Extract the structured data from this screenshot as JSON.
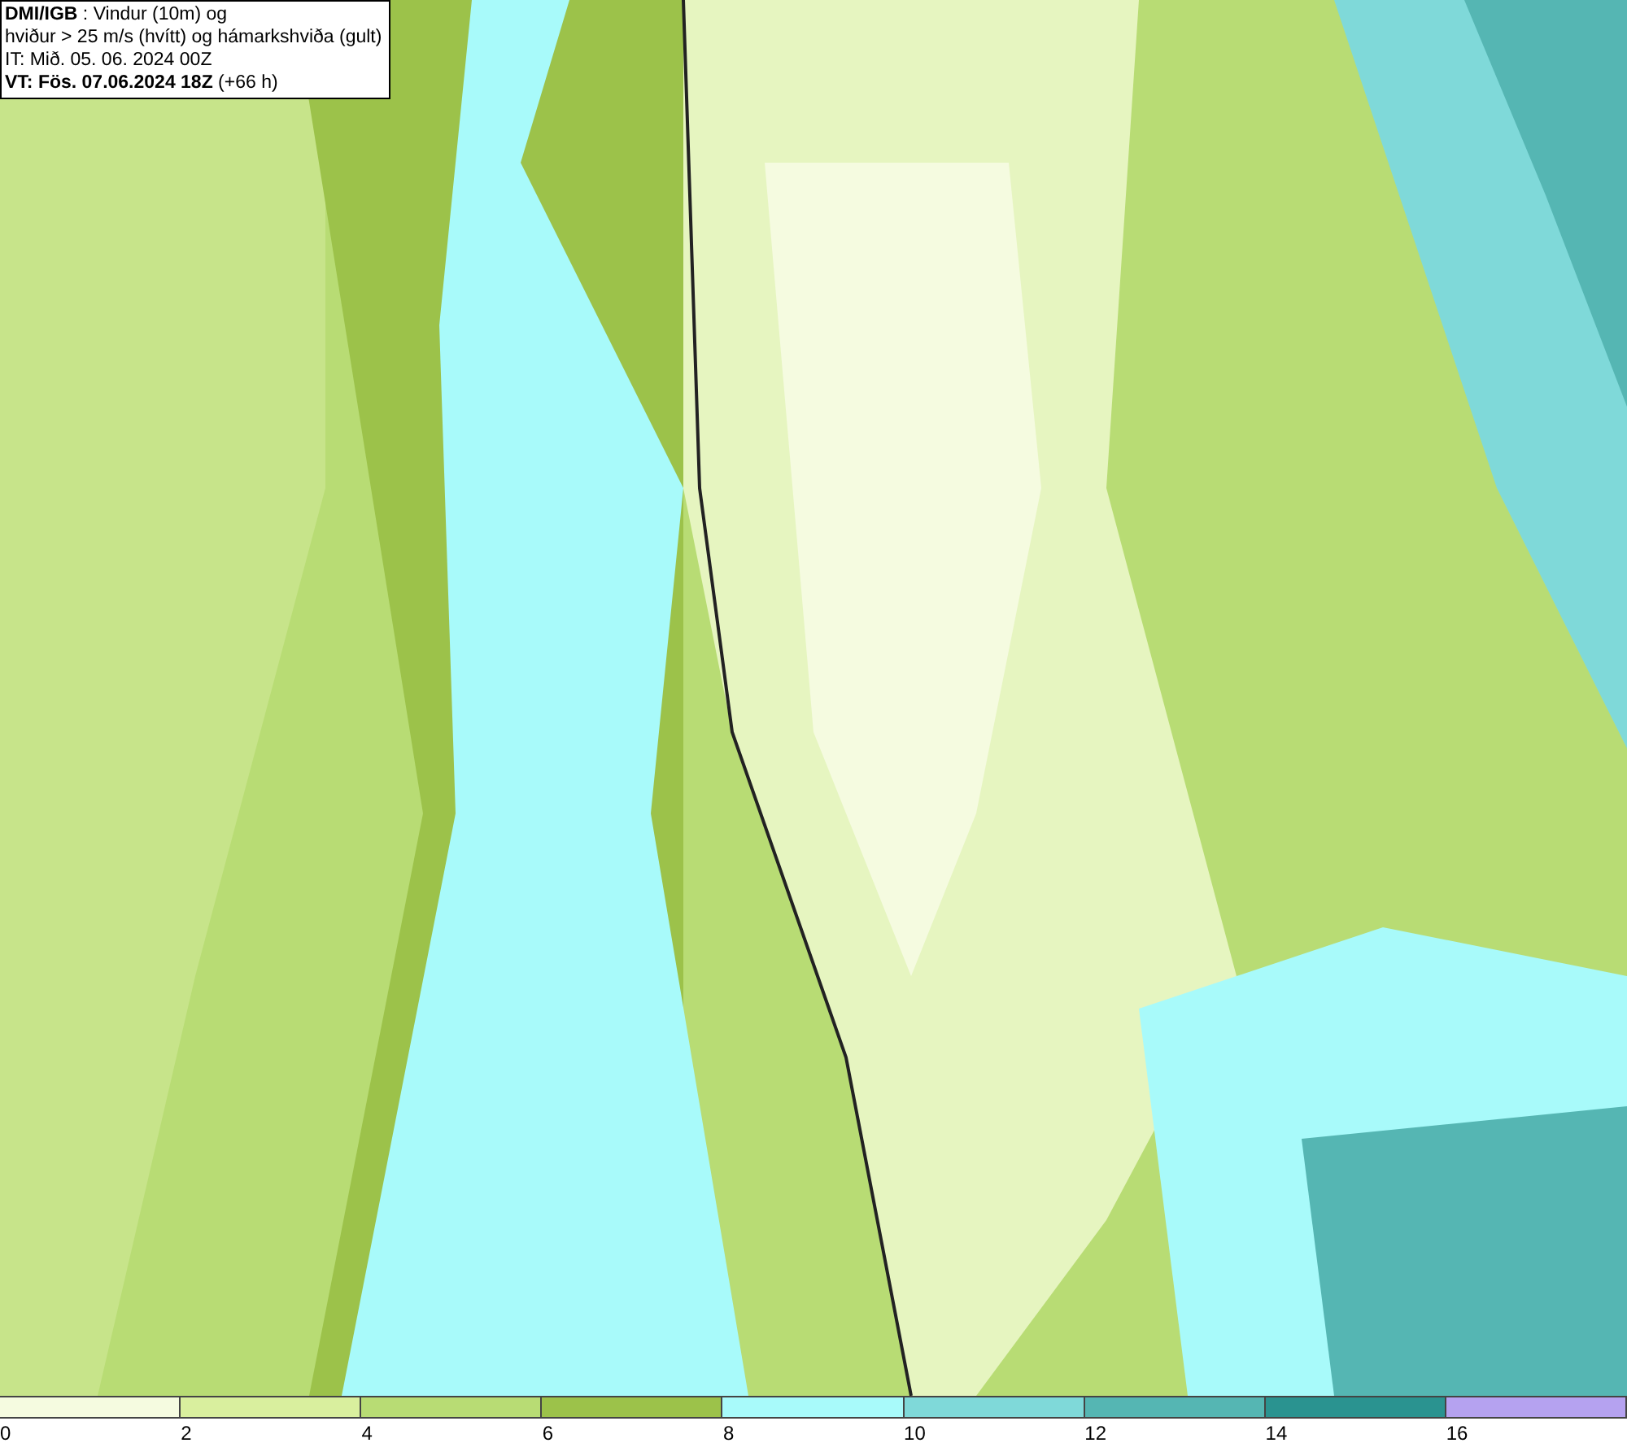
{
  "header": {
    "lines": [
      "**DMI/IGB** : Vindur (10m) og",
      "hviður > 25 m/s (hvítt) og hámarkshviða (gult)",
      "IT: Mið. 05. 06. 2024 00Z",
      "**VT: Fös. 07.06.2024 18Z** (+66 h)"
    ]
  },
  "legend": {
    "items": [
      {
        "color": "#f5fbe0",
        "tick": "0"
      },
      {
        "color": "#d9ef9e",
        "tick": "2"
      },
      {
        "color": "#b8dc74",
        "tick": "4"
      },
      {
        "color": "#9cc24a",
        "tick": "6"
      },
      {
        "color": "#a8fafa",
        "tick": "8"
      },
      {
        "color": "#7fd9d9",
        "tick": "10"
      },
      {
        "color": "#55b6b3",
        "tick": "12"
      },
      {
        "color": "#2a9390",
        "tick": "14"
      },
      {
        "color": "#b5a2f0",
        "tick": "16"
      }
    ]
  }
}
